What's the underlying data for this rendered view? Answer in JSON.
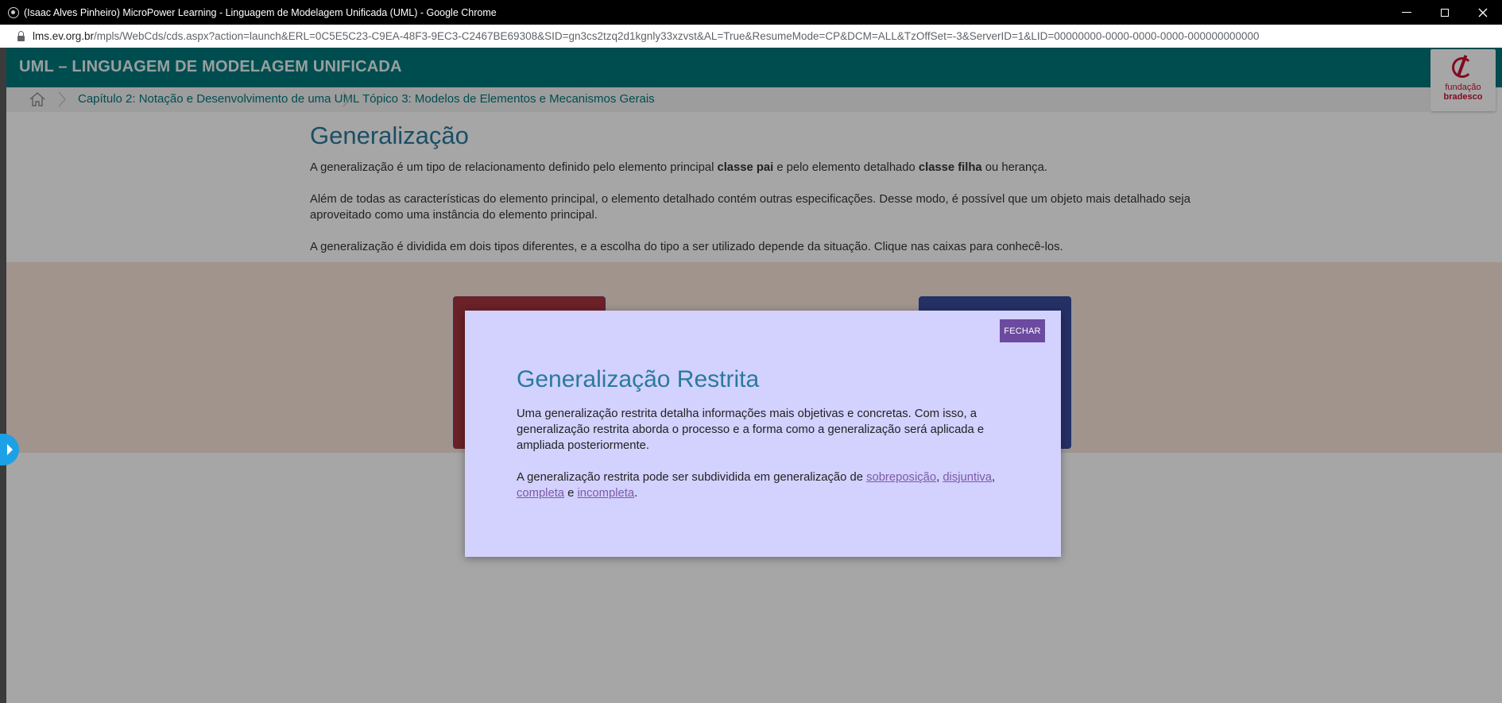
{
  "browser": {
    "window_title": "(Isaac Alves Pinheiro) MicroPower Learning - Linguagem de Modelagem Unificada (UML) - Google Chrome",
    "url_host": "lms.ev.org.br",
    "url_path": "/mpls/WebCds/cds.aspx?action=launch&ERL=0C5E5C23-C9EA-48F3-9EC3-C2467BE69308&SID=gn3cs2tzq2d1kgnly33xzvst&AL=True&ResumeMode=CP&DCM=ALL&TzOffSet=-3&ServerID=1&LID=00000000-0000-0000-0000-000000000000",
    "controls": [
      "minimize-icon",
      "maximize-icon",
      "close-icon"
    ]
  },
  "header": {
    "title": "UML – LINGUAGEM DE MODELAGEM UNIFICADA",
    "logo_line1": "fundação",
    "logo_line2": "bradesco",
    "brand_color": "#00777c"
  },
  "breadcrumb": {
    "home_icon": "home-icon",
    "items": [
      "Capítulo 2: Notação e Desenvolvimento de uma UML",
      "Tópico 3: Modelos de Elementos e Mecanismos Gerais"
    ]
  },
  "main": {
    "title": "Generalização",
    "p1_before": "A generalização é um tipo de relacionamento definido pelo elemento principal ",
    "p1_bold1": "classe pai",
    "p1_middle": " e pelo elemento detalhado ",
    "p1_bold2": "classe filha",
    "p1_after": " ou herança.",
    "p2": "Além de todas as características do elemento principal, o elemento detalhado contém outras especificações. Desse modo, é possível que um objeto mais detalhado seja aproveitado como uma instância do elemento principal.",
    "p3": "A generalização é dividida em dois tipos diferentes, e a escolha do tipo a ser utilizado depende da situação. Clique nas caixas para conhecê-los.",
    "card_colors": [
      "#a3333d",
      "#3a4a9c"
    ]
  },
  "modal": {
    "close_label": "FECHAR",
    "title": "Generalização Restrita",
    "p1": "Uma generalização restrita detalha informações mais objetivas e concretas. Com isso, a generalização restrita aborda o processo e a forma como a generalização será aplicada e ampliada posteriormente.",
    "p2_prefix": "A generalização restrita pode ser subdividida em generalização de ",
    "links": [
      "sobreposição",
      "disjuntiva",
      "completa",
      "incompleta"
    ],
    "sep1": ", ",
    "sep2": ",",
    "sep3": " e ",
    "end": ".",
    "background": "#d3d1fd"
  }
}
